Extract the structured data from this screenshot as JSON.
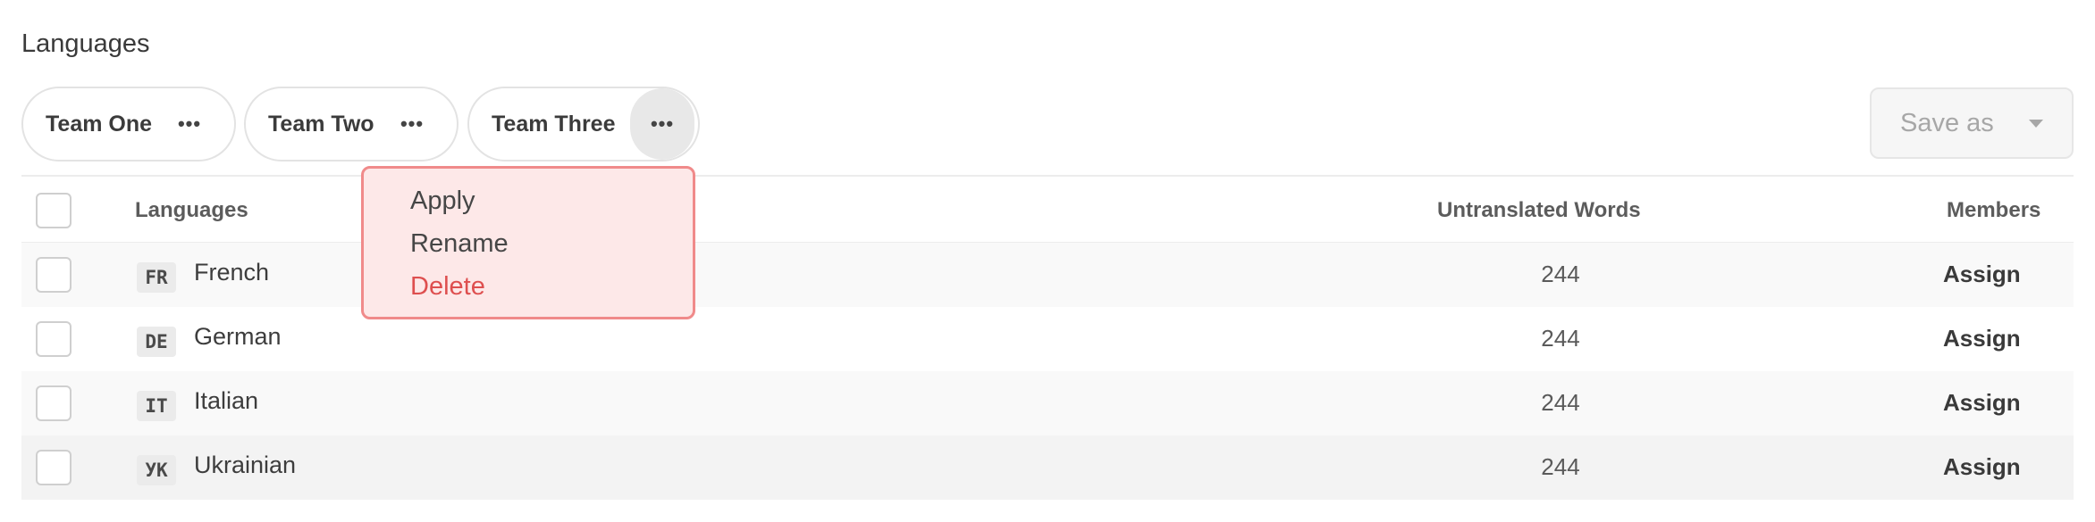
{
  "page": {
    "title": "Languages"
  },
  "tabs": [
    {
      "label": "Team One",
      "more": "•••"
    },
    {
      "label": "Team Two",
      "more": "•••"
    },
    {
      "label": "Team Three",
      "more": "•••"
    }
  ],
  "toolbar": {
    "save_label": "Save as",
    "save_caret_icon": "caret-down-icon"
  },
  "table": {
    "columns": {
      "languages": "Languages",
      "untranslated": "Untranslated Words",
      "members": "Members"
    },
    "rows": [
      {
        "code": "FR",
        "name": "French",
        "words": "244",
        "action": "Assign"
      },
      {
        "code": "DE",
        "name": "German",
        "words": "244",
        "action": "Assign"
      },
      {
        "code": "IT",
        "name": "Italian",
        "words": "244",
        "action": "Assign"
      },
      {
        "code": "УК",
        "name": "Ukrainian",
        "words": "244",
        "action": "Assign"
      }
    ]
  },
  "context_menu": {
    "items": [
      {
        "label": "Apply"
      },
      {
        "label": "Rename"
      },
      {
        "label": "Delete"
      }
    ],
    "colors": {
      "background": "#fde8e8",
      "border": "#f08a8a",
      "danger": "#de4f4f"
    }
  }
}
